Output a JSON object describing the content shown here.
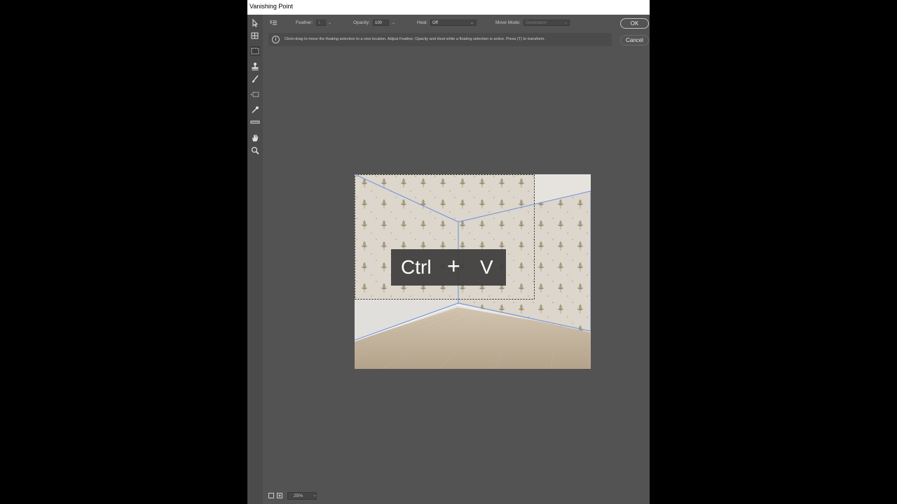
{
  "window": {
    "title": "Vanishing Point"
  },
  "options": {
    "feather_label": "Feather:",
    "feather_value": "1",
    "opacity_label": "Opacity:",
    "opacity_value": "100",
    "heal_label": "Heal:",
    "heal_value": "Off",
    "move_mode_label": "Move Mode:",
    "move_mode_value": "Destination"
  },
  "buttons": {
    "ok": "OK",
    "cancel": "Cancel"
  },
  "info": {
    "text": "Click+drag to move the floating selection to a new location. Adjust Feather, Opacity and Heal while a floating selection is active. Press (T) to transform."
  },
  "tools": [
    {
      "name": "edit-plane-icon"
    },
    {
      "name": "create-plane-icon"
    },
    {
      "name": "marquee-icon",
      "selected": true
    },
    {
      "name": "stamp-icon"
    },
    {
      "name": "brush-icon"
    },
    {
      "name": "transform-icon"
    },
    {
      "name": "eyedropper-icon"
    },
    {
      "name": "measure-icon"
    },
    {
      "name": "hand-icon"
    },
    {
      "name": "zoom-icon"
    }
  ],
  "overlay": {
    "ctrl": "Ctrl",
    "plus": "+",
    "v": "V"
  },
  "status": {
    "zoom": "25%"
  },
  "colors": {
    "dialog_bg": "#535353",
    "toolbar_bg": "#4b4b4b",
    "plane_grid": "#6d8fe0"
  }
}
